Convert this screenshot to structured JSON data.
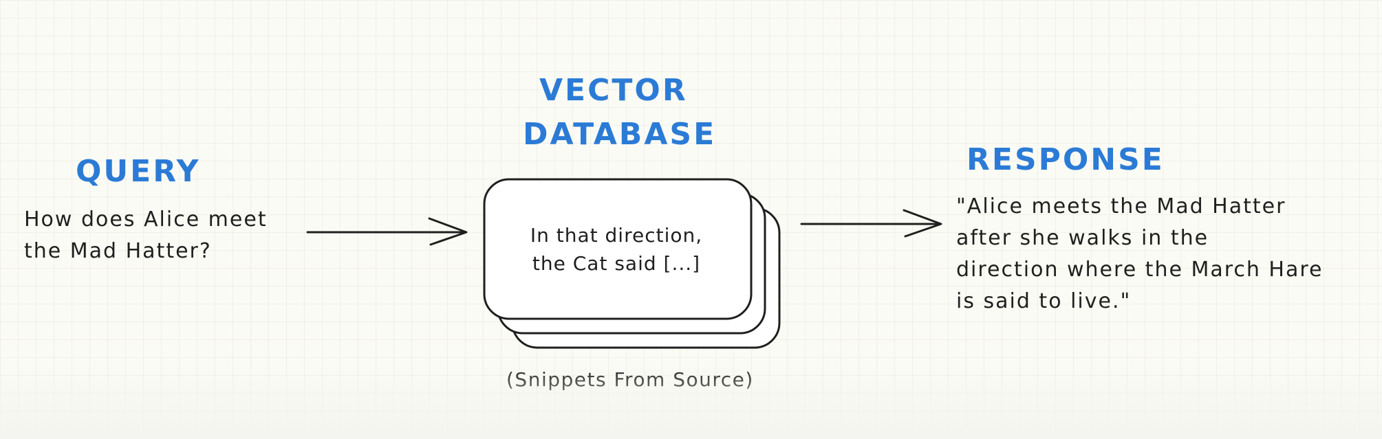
{
  "query": {
    "heading": "QUERY",
    "lines": [
      "How does Alice meet",
      "the Mad Hatter?"
    ]
  },
  "vector_database": {
    "heading_lines": [
      "VECTOR",
      "DATABASE"
    ],
    "snippet_lines": [
      "In that direction,",
      "the Cat said [...]"
    ],
    "caption": "(Snippets From Source)"
  },
  "response": {
    "heading": "RESPONSE",
    "lines": [
      "\"Alice meets the Mad Hatter",
      "after she walks in the",
      "direction where the March Hare",
      "is said to live.\""
    ]
  },
  "colors": {
    "heading": "#2b7bd6",
    "ink": "#1f1f1f",
    "background": "#fbfbf5"
  }
}
